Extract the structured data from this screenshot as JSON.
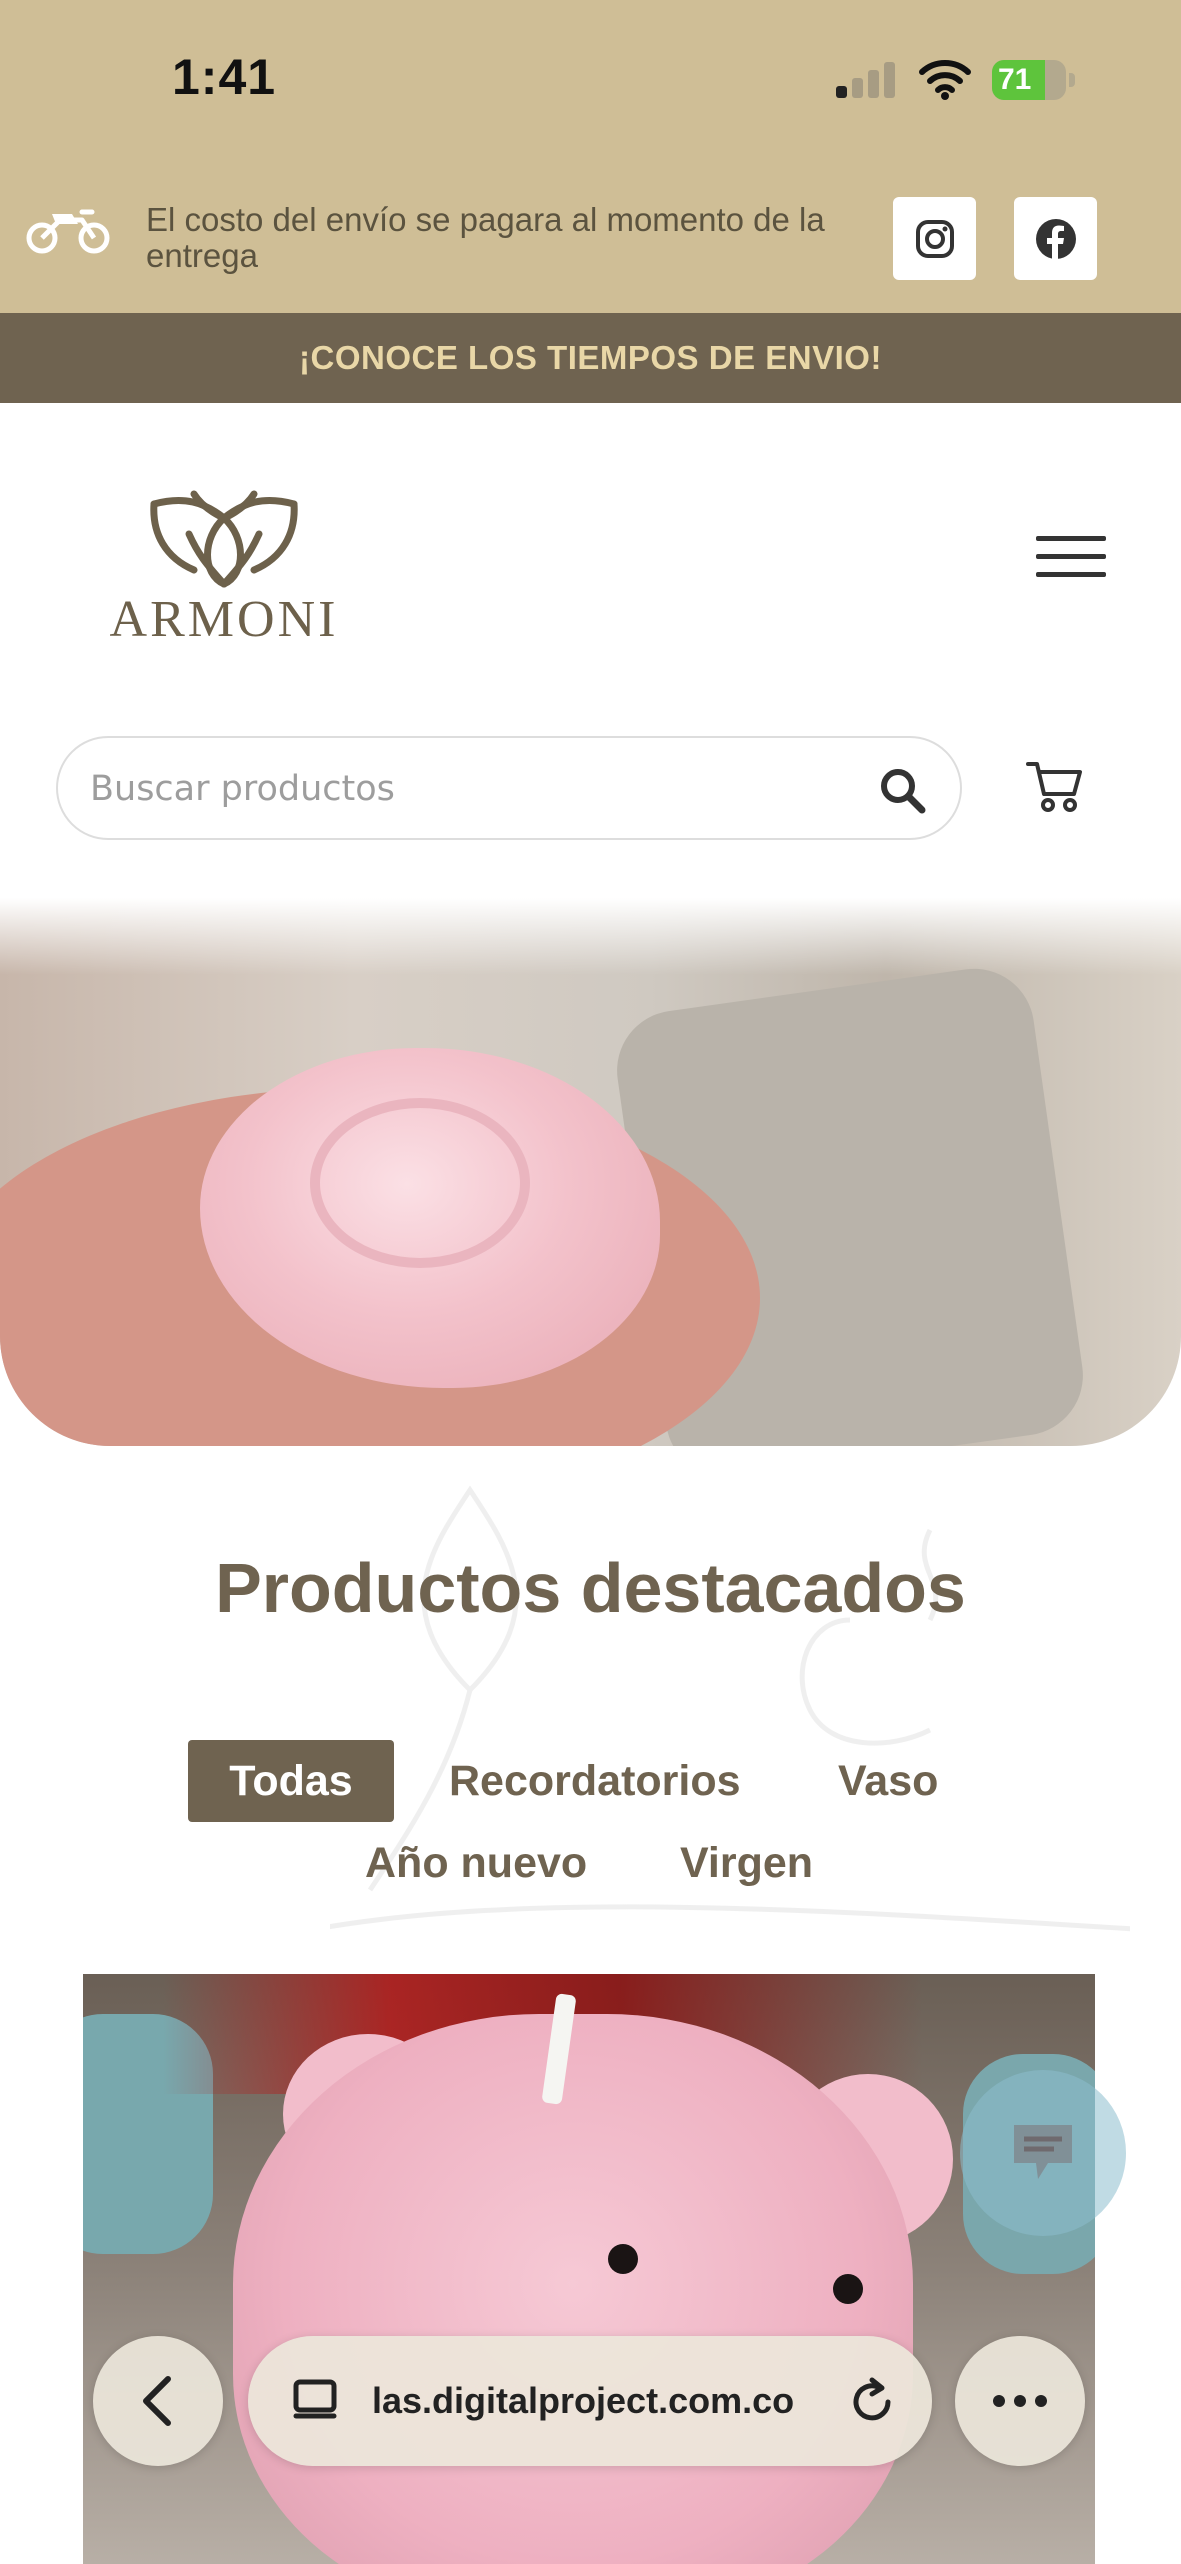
{
  "status_bar": {
    "time": "1:41",
    "battery": "71",
    "battery_level": 0.71
  },
  "top_bar": {
    "shipping_notice": "El costo del envío se pagara al momento de la entrega"
  },
  "ribbon": {
    "text": "¡CONOCE LOS TIEMPOS DE ENVIO!"
  },
  "header": {
    "logo_text": "ARMONI"
  },
  "search": {
    "placeholder": "Buscar productos"
  },
  "featured": {
    "title": "Productos destacados",
    "tabs": [
      "Todas",
      "Recordatorios",
      "Vaso",
      "Año nuevo",
      "Virgen"
    ],
    "active_tab": "Todas"
  },
  "browser": {
    "url": "las.digitalproject.com.co"
  },
  "colors": {
    "accent": "#6f6350",
    "banner": "#cfbe96",
    "ribbon_text": "#e9d7a7"
  },
  "icons": [
    "motorcycle-icon",
    "instagram-icon",
    "facebook-icon",
    "hamburger-menu-icon",
    "search-icon",
    "cart-icon",
    "chat-icon",
    "back-arrow-icon",
    "tabs-icon",
    "reload-icon",
    "more-icon"
  ]
}
